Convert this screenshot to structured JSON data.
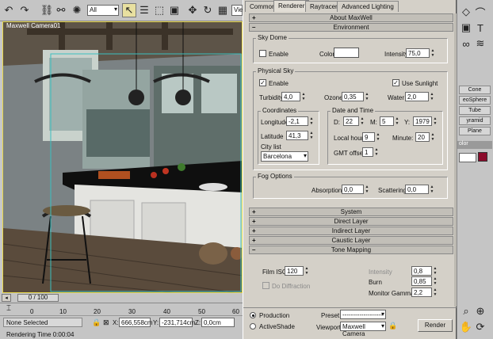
{
  "toolbar": {
    "filter": "All",
    "truncated_field": "Vie"
  },
  "viewport": {
    "label": "Maxwell Camera01"
  },
  "dialog": {
    "tabs": [
      "Common",
      "Renderer",
      "Raytracer",
      "Advanced Lighting"
    ],
    "rollouts": {
      "about": "About MaxWell",
      "environment": "Environment"
    },
    "sky_dome": {
      "title": "Sky Dome",
      "enable_label": "Enable",
      "enabled": false,
      "color_label": "Color",
      "color": "#ffffff",
      "intensity_label": "Intensity",
      "intensity": "75,0"
    },
    "physical_sky": {
      "title": "Physical Sky",
      "enable_label": "Enable",
      "enabled": true,
      "use_sunlight_label": "Use Sunlight",
      "use_sunlight": true,
      "turbidity_label": "Turbidity",
      "turbidity": "4,0",
      "ozone_label": "Ozone",
      "ozone": "0,35",
      "water_label": "Water",
      "water": "2,0",
      "coordinates": {
        "title": "Coordinates",
        "longitude_label": "Longitude",
        "longitude": "-2,1",
        "latitude_label": "Latitude",
        "latitude": "41,3",
        "city_label": "City list",
        "city": "Barcelona"
      },
      "date_time": {
        "title": "Date and Time",
        "d_label": "D:",
        "d": "22",
        "m_label": "M:",
        "m": "5",
        "y_label": "Y:",
        "y": "1979",
        "local_hour_label": "Local hour:",
        "local_hour": "9",
        "minute_label": "Minute:",
        "minute": "20",
        "gmt_label": "GMT offset:",
        "gmt": "1"
      }
    },
    "fog": {
      "title": "Fog Options",
      "absorption_label": "Absorption:",
      "absorption": "0,0",
      "scattering_label": "Scattering:",
      "scattering": "0,0"
    },
    "rollouts2": {
      "system": "System",
      "direct": "Direct Layer",
      "indirect": "Indirect Layer",
      "caustic": "Caustic Layer",
      "tone": "Tone Mapping"
    },
    "tone": {
      "film_iso_label": "Film ISO:",
      "film_iso": "120",
      "intensity_label": "Intensity",
      "intensity": "0,8",
      "burn_label": "Burn",
      "burn": "0,85",
      "diffraction_label": "Do Diffraction",
      "gamma_label": "Monitor Gamma:",
      "gamma": "2,2"
    },
    "bottom": {
      "production_label": "Production",
      "activeshade_label": "ActiveShade",
      "preset_label": "Preset:",
      "preset": "--------------------",
      "viewport_label": "Viewport:",
      "viewport": "Maxwell Camera",
      "render_label": "Render"
    }
  },
  "command_panel": {
    "buttons": [
      "Cone",
      "eoSphere",
      "Tube",
      "yramid",
      "Plane"
    ],
    "color_label": "olor",
    "swatch": "#8b0a2a"
  },
  "timeline": {
    "frame": "0 / 100",
    "ticks": [
      "0",
      "10",
      "20",
      "30",
      "40",
      "50",
      "60"
    ]
  },
  "status": {
    "selection": "None Selected",
    "x_label": "X:",
    "x": "666,558cm",
    "y_label": "Y:",
    "y": "-231,714cm",
    "z_label": "Z:",
    "z": "0,0cm",
    "render_time": "Rendering Time  0:00:04"
  }
}
